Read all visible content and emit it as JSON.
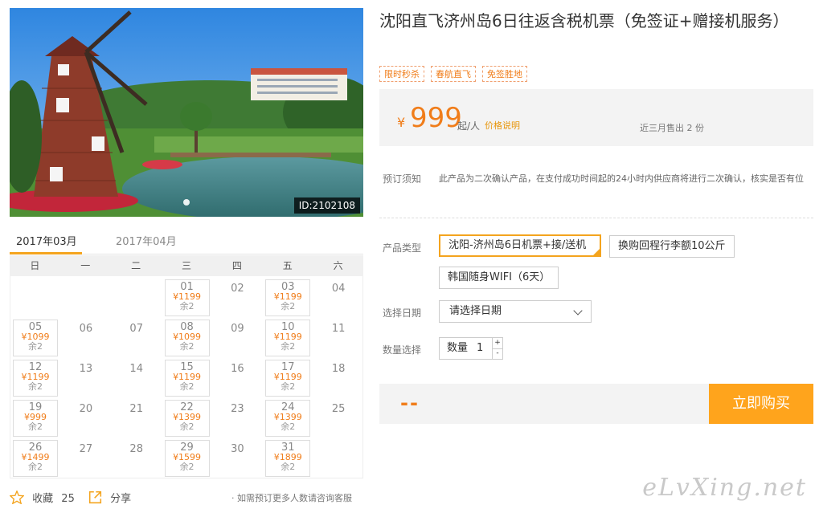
{
  "photo": {
    "id_label": "ID:2102108"
  },
  "calendar": {
    "months": [
      "2017年03月",
      "2017年04月"
    ],
    "weekdays": [
      "日",
      "一",
      "二",
      "三",
      "四",
      "五",
      "六"
    ],
    "weeks": [
      [
        null,
        null,
        null,
        {
          "day": "01",
          "price": "¥1199",
          "left": "余2"
        },
        {
          "day": "02"
        },
        {
          "day": "03",
          "price": "¥1199",
          "left": "余2"
        },
        {
          "day": "04"
        }
      ],
      [
        {
          "day": "05",
          "price": "¥1099",
          "left": "余2"
        },
        {
          "day": "06"
        },
        {
          "day": "07"
        },
        {
          "day": "08",
          "price": "¥1099",
          "left": "余2"
        },
        {
          "day": "09"
        },
        {
          "day": "10",
          "price": "¥1199",
          "left": "余2"
        },
        {
          "day": "11"
        }
      ],
      [
        {
          "day": "12",
          "price": "¥1199",
          "left": "余2"
        },
        {
          "day": "13"
        },
        {
          "day": "14"
        },
        {
          "day": "15",
          "price": "¥1199",
          "left": "余2"
        },
        {
          "day": "16"
        },
        {
          "day": "17",
          "price": "¥1199",
          "left": "余2"
        },
        {
          "day": "18"
        }
      ],
      [
        {
          "day": "19",
          "price": "¥999",
          "left": "余2"
        },
        {
          "day": "20"
        },
        {
          "day": "21"
        },
        {
          "day": "22",
          "price": "¥1399",
          "left": "余2"
        },
        {
          "day": "23"
        },
        {
          "day": "24",
          "price": "¥1399",
          "left": "余2"
        },
        {
          "day": "25"
        }
      ],
      [
        {
          "day": "26",
          "price": "¥1499",
          "left": "余2"
        },
        {
          "day": "27"
        },
        {
          "day": "28"
        },
        {
          "day": "29",
          "price": "¥1599",
          "left": "余2"
        },
        {
          "day": "30"
        },
        {
          "day": "31",
          "price": "¥1899",
          "left": "余2"
        },
        null
      ]
    ]
  },
  "footer": {
    "favorite_label": "收藏",
    "favorite_count": "25",
    "share_label": "分享",
    "consult_text": "· 如需预订更多人数请咨询客服"
  },
  "product": {
    "title": "沈阳直飞济州岛6日往返含税机票（免签证+赠接机服务）",
    "tags": [
      "限时秒杀",
      "春航直飞",
      "免签胜地"
    ],
    "currency": "¥",
    "price": "999",
    "price_unit": "起/人",
    "price_note_link": "价格说明",
    "sold_text": "近三月售出 2 份"
  },
  "booking": {
    "notice_label": "预订须知",
    "notice_text": "此产品为二次确认产品，在支付成功时间起的24小时内供应商将进行二次确认，核实是否有位",
    "type_label": "产品类型",
    "types": [
      "沈阳-济州岛6日机票+接/送机",
      "换购回程行李额10公斤",
      "韩国随身WIFI（6天）"
    ],
    "date_label": "选择日期",
    "date_placeholder": "请选择日期",
    "qty_label": "数量选择",
    "qty_prefix": "数量",
    "qty_value": "1",
    "plus": "+",
    "minus": "-",
    "total": "--",
    "buy_label": "立即购买"
  },
  "watermark": "eLvXing.net",
  "colors": {
    "accent": "#f07d1a",
    "buy_button": "#ffa41c"
  }
}
